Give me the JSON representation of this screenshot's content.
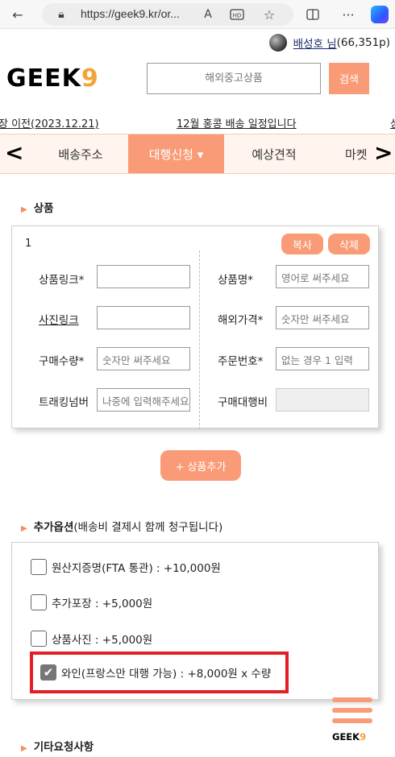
{
  "browser": {
    "url": "https://geek9.kr/or..."
  },
  "header": {
    "user_name": "배성호 님",
    "points": "(66,351p)",
    "logo_text": "GEEK",
    "logo_suffix": "9",
    "search_placeholder": "해외중고상품",
    "search_button": "검색"
  },
  "notices": {
    "left": "장 이전(2023.12.21)",
    "center": "12월 홍콩 배송 일정입니다",
    "right": "상"
  },
  "nav": {
    "tabs": [
      "배송주소",
      "대행신청 ▾",
      "예상견적",
      "마켓"
    ],
    "active_index": 1,
    "prev_arrow": "<",
    "next_arrow": ">"
  },
  "product_section": {
    "title": "상품",
    "item_number": "1",
    "copy_button": "복사",
    "delete_button": "삭제",
    "fields": {
      "link_label": "상품링크*",
      "name_label": "상품명*",
      "name_placeholder": "영어로 써주세요",
      "photo_label": "사진링크",
      "price_label": "해외가격*",
      "price_placeholder": "숫자만 써주세요",
      "qty_label": "구매수량*",
      "qty_placeholder": "숫자만 써주세요",
      "order_label": "주문번호*",
      "order_placeholder": "없는 경우 1 입력",
      "tracking_label": "트래킹넘버",
      "tracking_placeholder": "나중에 입력해주세요",
      "fee_label": "구매대행비"
    },
    "add_button": "+ 상품추가"
  },
  "options_section": {
    "title": "추가옵션",
    "subtitle": "(배송비 결제시 함께 청구됩니다)",
    "options": [
      {
        "label": "원산지증명(FTA 통관) : +10,000원",
        "checked": false
      },
      {
        "label": "추가포장 : +5,000원",
        "checked": false
      },
      {
        "label": "상품사진 : +5,000원",
        "checked": false
      },
      {
        "label": "와인(프랑스만 대행 가능) : +8,000원 x 수량",
        "checked": true
      }
    ]
  },
  "etc_section": {
    "title": "기타요청사항"
  },
  "fab": {
    "logo_text": "GEEK",
    "logo_suffix": "9"
  },
  "colors": {
    "accent": "#fa9b78",
    "highlight_border": "#e31e24",
    "logo_nine": "#f2a43a"
  }
}
